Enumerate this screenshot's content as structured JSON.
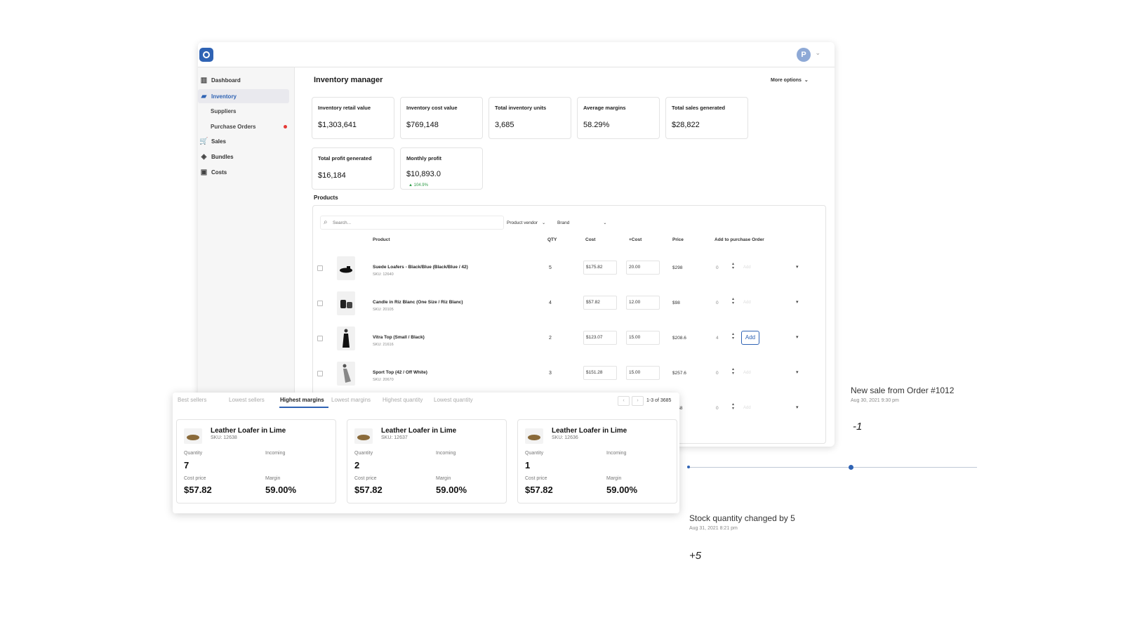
{
  "app": {
    "avatar_letter": "P",
    "brand_color": "#2f63b4"
  },
  "sidebar": {
    "items": [
      {
        "label": "Dashboard",
        "icon": "bar-chart-icon"
      },
      {
        "label": "Inventory",
        "icon": "shopping-bag-icon",
        "active": true
      },
      {
        "label": "Suppliers"
      },
      {
        "label": "Purchase Orders",
        "has_alert": true
      },
      {
        "label": "Sales",
        "icon": "cart-icon"
      },
      {
        "label": "Bundles",
        "icon": "tags-icon"
      },
      {
        "label": "Costs",
        "icon": "cash-icon"
      }
    ]
  },
  "header": {
    "title": "Inventory manager",
    "more_options": "More options"
  },
  "kpis": [
    {
      "label": "Inventory retail value",
      "value": "$1,303,641"
    },
    {
      "label": "Inventory cost value",
      "value": "$769,148"
    },
    {
      "label": "Total inventory units",
      "value": "3,685"
    },
    {
      "label": "Average margins",
      "value": "58.29%"
    },
    {
      "label": "Total sales generated",
      "value": "$28,822"
    },
    {
      "label": "Total profit generated",
      "value": "$16,184"
    },
    {
      "label": "Monthly profit",
      "value": "$10,893.0",
      "delta": "▲ 104.9%"
    }
  ],
  "products": {
    "section_label": "Products",
    "search_placeholder": "Search...",
    "filters": [
      "Product vendor",
      "Brand"
    ],
    "columns": [
      "Product",
      "QTY",
      "Cost",
      "+Cost",
      "Price",
      "Add to purchase Order"
    ],
    "rows": [
      {
        "name": "Suede Loafers - Black/Blue (Black/Blue / 42)",
        "sku": "SKU: 12640",
        "qty": "5",
        "cost": "$175.82",
        "plus_cost": "20.00",
        "price": "$298",
        "po_qty": "0",
        "po_action": "Add"
      },
      {
        "name": "Candle in Riz Blanc (One Size / Riz Blanc)",
        "sku": "SKU: 20105",
        "qty": "4",
        "cost": "$57.82",
        "plus_cost": "12.00",
        "price": "$98",
        "po_qty": "0",
        "po_action": "Add"
      },
      {
        "name": "Vitra Top (Small / Black)",
        "sku": "SKU: 21616",
        "qty": "2",
        "cost": "$123.07",
        "plus_cost": "15.00",
        "price": "$208.6",
        "po_qty": "4",
        "po_action": "Add"
      },
      {
        "name": "Sport Top (42 / Off White)",
        "sku": "SKU: 20670",
        "qty": "3",
        "cost": "$151.28",
        "plus_cost": "15.00",
        "price": "$257.6",
        "po_qty": "0",
        "po_action": "Add"
      },
      {
        "name": "",
        "sku": "",
        "qty": "",
        "cost": "",
        "plus_cost": "",
        "price": "$458",
        "po_qty": "0",
        "po_action": "Add"
      }
    ]
  },
  "best_sellers": {
    "tabs": [
      "Best sellers",
      "Lowest sellers",
      "Highest margins",
      "Lowest margins",
      "Highest quantity",
      "Lowest quantity"
    ],
    "active_tab": "Highest margins",
    "pagination": "1-3 of 3685",
    "cards": [
      {
        "name": "Leather Loafer in Lime",
        "sku": "SKU: 12638",
        "quantity_label": "Quantity",
        "quantity": "7",
        "incoming_label": "Incoming",
        "cost_label": "Cost price",
        "cost": "$57.82",
        "margin_label": "Margin",
        "margin": "59.00%"
      },
      {
        "name": "Leather Loafer in Lime",
        "sku": "SKU: 12637",
        "quantity_label": "Quantity",
        "quantity": "2",
        "incoming_label": "Incoming",
        "cost_label": "Cost price",
        "cost": "$57.82",
        "margin_label": "Margin",
        "margin": "59.00%"
      },
      {
        "name": "Leather Loafer in Lime",
        "sku": "SKU: 12636",
        "quantity_label": "Quantity",
        "quantity": "1",
        "incoming_label": "Incoming",
        "cost_label": "Cost price",
        "cost": "$57.82",
        "margin_label": "Margin",
        "margin": "59.00%"
      }
    ]
  },
  "events": [
    {
      "title": "New sale from Order #1012",
      "date": "Aug 30, 2021 9:30 pm",
      "delta": "-1"
    },
    {
      "title": "Stock quantity changed by 5",
      "date": "Aug 31, 2021 8:21 pm",
      "delta": "+5"
    }
  ]
}
